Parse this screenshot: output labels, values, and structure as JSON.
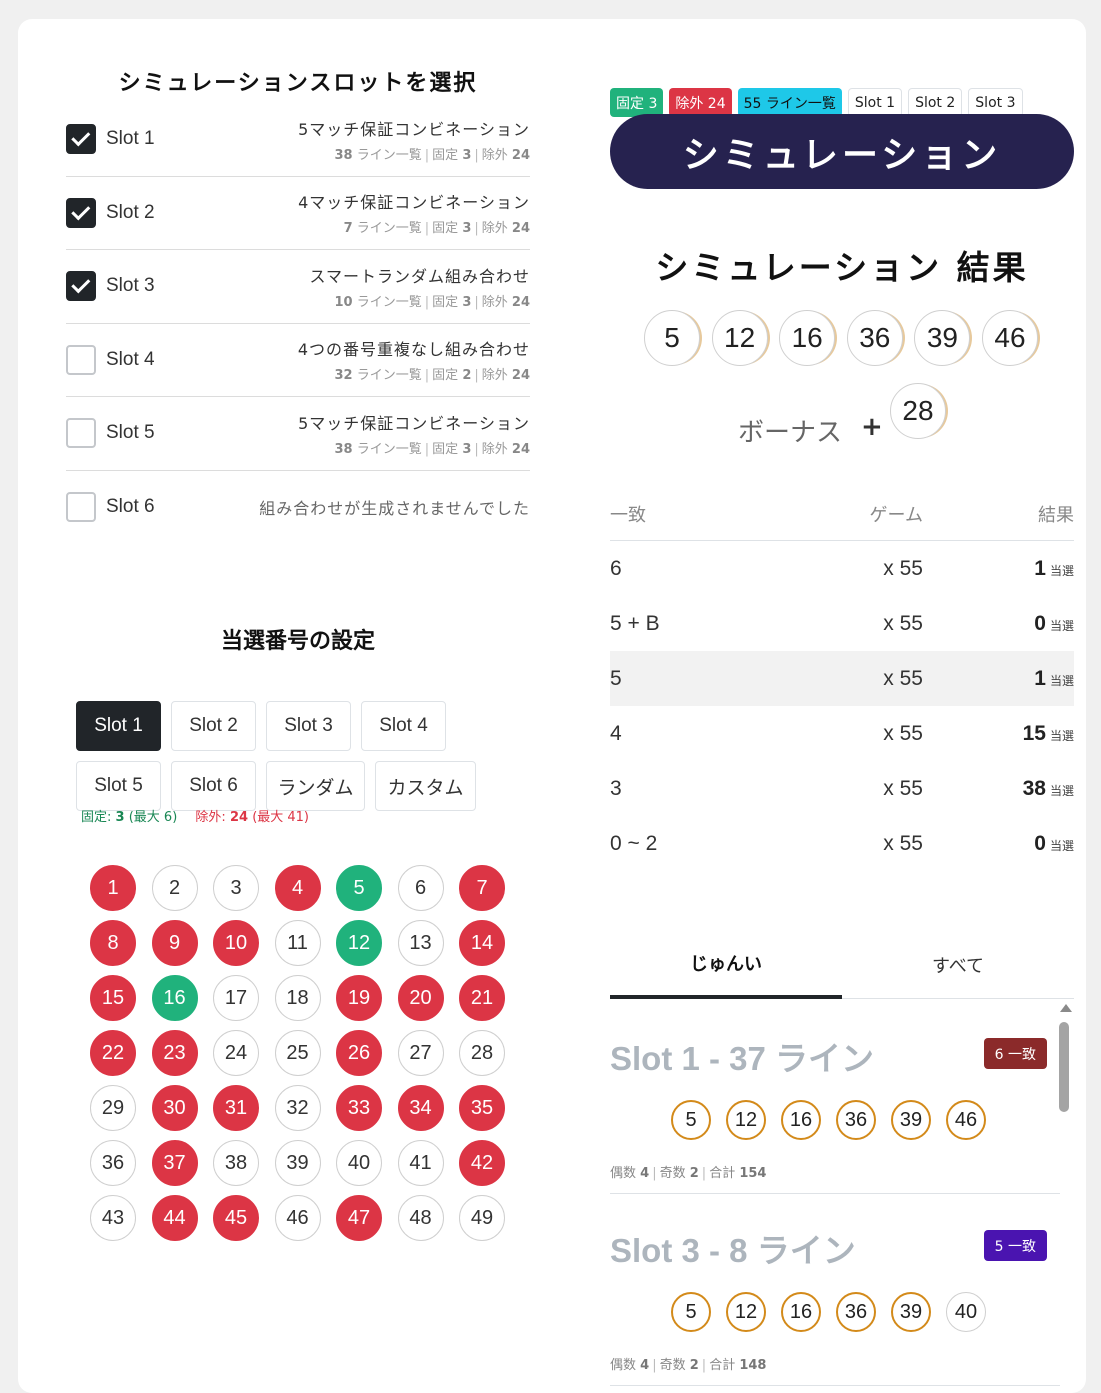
{
  "left": {
    "slot_title": "シミュレーションスロットを選択",
    "slots": [
      {
        "name": "Slot 1",
        "checked": true,
        "title": "5マッチ保証コンビネーション",
        "lines": "38",
        "lines_label": "ライン一覧",
        "fixed_label": "固定",
        "fixed": "3",
        "excl_label": "除外",
        "excl": "24"
      },
      {
        "name": "Slot 2",
        "checked": true,
        "title": "4マッチ保証コンビネーション",
        "lines": "7",
        "lines_label": "ライン一覧",
        "fixed_label": "固定",
        "fixed": "3",
        "excl_label": "除外",
        "excl": "24"
      },
      {
        "name": "Slot 3",
        "checked": true,
        "title": "スマートランダム組み合わせ",
        "lines": "10",
        "lines_label": "ライン一覧",
        "fixed_label": "固定",
        "fixed": "3",
        "excl_label": "除外",
        "excl": "24"
      },
      {
        "name": "Slot 4",
        "checked": false,
        "title": "4つの番号重複なし組み合わせ",
        "lines": "32",
        "lines_label": "ライン一覧",
        "fixed_label": "固定",
        "fixed": "2",
        "excl_label": "除外",
        "excl": "24"
      },
      {
        "name": "Slot 5",
        "checked": false,
        "title": "5マッチ保証コンビネーション",
        "lines": "38",
        "lines_label": "ライン一覧",
        "fixed_label": "固定",
        "fixed": "3",
        "excl_label": "除外",
        "excl": "24"
      },
      {
        "name": "Slot 6",
        "checked": false,
        "empty": "組み合わせが生成されませんでした"
      }
    ],
    "winning_title": "当選番号の設定",
    "buttons": [
      "Slot 1",
      "Slot 2",
      "Slot 3",
      "Slot 4",
      "Slot 5",
      "Slot 6",
      "ランダム",
      "カスタム"
    ],
    "active_button": "Slot 1",
    "limits": {
      "fixed_label": "固定:",
      "fixed": "3",
      "fixed_max": "(最大 6)",
      "excl_label": "除外:",
      "excl": "24",
      "excl_max": "(最大 41)"
    },
    "numbers": {
      "fixed": [
        5,
        12,
        16
      ],
      "excluded": [
        1,
        4,
        7,
        8,
        9,
        10,
        14,
        15,
        19,
        20,
        21,
        22,
        23,
        26,
        30,
        31,
        33,
        34,
        35,
        37,
        42,
        44,
        45,
        47
      ],
      "max": 49
    }
  },
  "right": {
    "badges": [
      {
        "text": "固定 3",
        "style": "g"
      },
      {
        "text": "除外 24",
        "style": "r"
      },
      {
        "text": "55 ライン一覧",
        "style": "c"
      },
      {
        "text": "Slot 1",
        "style": "w"
      },
      {
        "text": "Slot 2",
        "style": "w"
      },
      {
        "text": "Slot 3",
        "style": "w"
      }
    ],
    "sim_button": "シミュレーション",
    "result_title": "シミュレーション 結果",
    "result_numbers": [
      5,
      12,
      16,
      36,
      39,
      46
    ],
    "bonus_label": "ボーナス",
    "bonus_plus": "+",
    "bonus_number": 28,
    "table": {
      "headers": [
        "一致",
        "ゲーム",
        "結果"
      ],
      "unit": "当選",
      "rows": [
        {
          "match": "6",
          "games": "x 55",
          "result": "1"
        },
        {
          "match": "5 + B",
          "games": "x 55",
          "result": "0"
        },
        {
          "match": "5",
          "games": "x 55",
          "result": "1",
          "highlight": true
        },
        {
          "match": "4",
          "games": "x 55",
          "result": "15"
        },
        {
          "match": "3",
          "games": "x 55",
          "result": "38"
        },
        {
          "match": "0 ~ 2",
          "games": "x 55",
          "result": "0"
        }
      ]
    },
    "tabs": [
      "じゅんい",
      "すべて"
    ],
    "ranks": [
      {
        "title": "Slot 1 - 37 ライン",
        "badge": "6 一致",
        "badge_color": "#8b2a2a",
        "balls": [
          5,
          12,
          16,
          36,
          39,
          46
        ],
        "matched": [
          5,
          12,
          16,
          36,
          39,
          46
        ],
        "even_label": "偶数",
        "even": "4",
        "odd_label": "奇数",
        "odd": "2",
        "sum_label": "合計",
        "sum": "154"
      },
      {
        "title": "Slot 3 - 8 ライン",
        "badge": "5 一致",
        "badge_color": "#4a14b0",
        "balls": [
          5,
          12,
          16,
          36,
          39,
          40
        ],
        "matched": [
          5,
          12,
          16,
          36,
          39
        ],
        "even_label": "偶数",
        "even": "4",
        "odd_label": "奇数",
        "odd": "2",
        "sum_label": "合計",
        "sum": "148"
      }
    ]
  }
}
